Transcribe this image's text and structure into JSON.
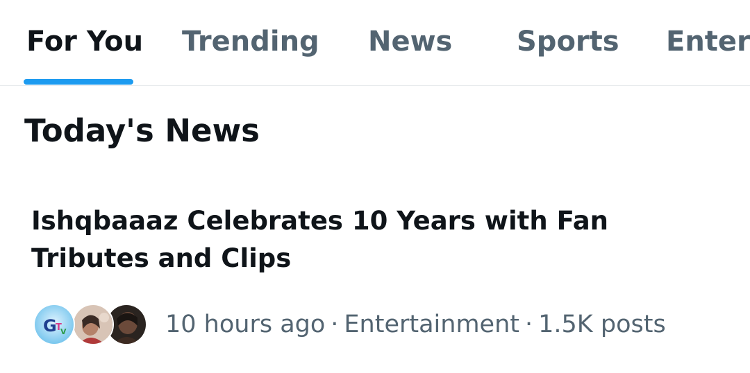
{
  "tabs": [
    {
      "label": "For You",
      "active": true
    },
    {
      "label": "Trending",
      "active": false
    },
    {
      "label": "News",
      "active": false
    },
    {
      "label": "Sports",
      "active": false
    },
    {
      "label": "Entert",
      "active": false
    }
  ],
  "section": {
    "title": "Today's News"
  },
  "story": {
    "headline": "Ishqbaaaz Celebrates 10 Years with Fan Tributes and Clips",
    "time": "10 hours ago",
    "category": "Entertainment",
    "posts": "1.5K posts",
    "separator": "·",
    "avatars": [
      {
        "icon": "gtv-logo-icon",
        "letters": "GTV"
      },
      {
        "icon": "user-photo-icon"
      },
      {
        "icon": "user-photo-icon"
      }
    ]
  },
  "colors": {
    "accent": "#1d9bf0",
    "text_primary": "#0f1419",
    "text_secondary": "#536471",
    "divider": "#e6e9ec"
  }
}
